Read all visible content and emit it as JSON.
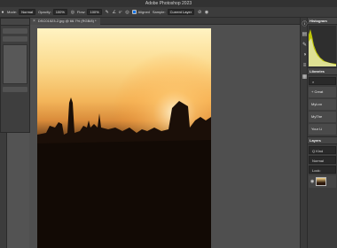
{
  "app": {
    "title": "Adobe Photoshop 2023"
  },
  "options_bar": {
    "mode_label": "Mode:",
    "mode_value": "Normal",
    "opacity_label": "Opacity:",
    "opacity_value": "100%",
    "flow_label": "Flow:",
    "flow_value": "100%",
    "smoothing_value": "0°",
    "aligned_label": "Aligned",
    "sample_label": "Sample:",
    "sample_value": "Current Layer"
  },
  "document": {
    "tab_title": "DSC01523-2.jpg @ 66.7% (RGB/8) *"
  },
  "right_panel": {
    "histogram_title": "Histogram",
    "libraries_title": "Libraries",
    "create_label": "+ Creat",
    "library_items": [
      "MyLoo",
      "MyThe",
      "Your Li"
    ],
    "layers_title": "Layers",
    "kind_label": "Q Kind",
    "blend_label": "Normal",
    "lock_label": "Lock:"
  }
}
